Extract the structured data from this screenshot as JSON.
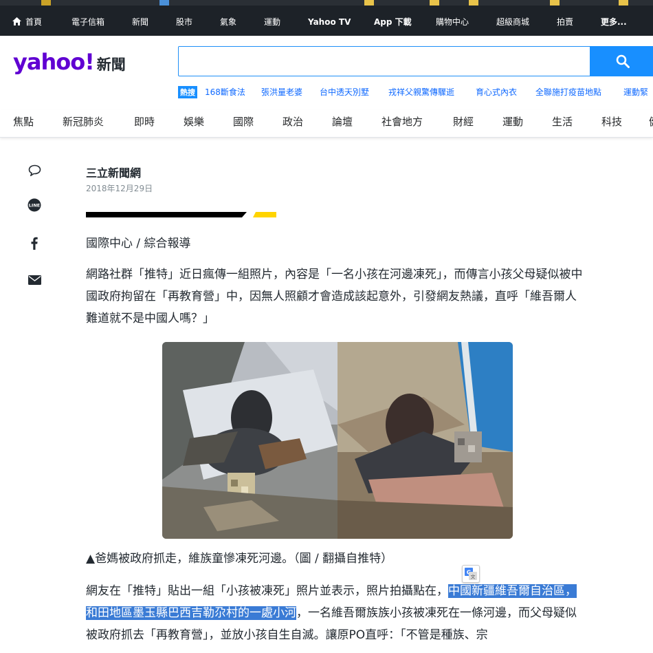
{
  "topnav": {
    "items": [
      "首頁",
      "電子信箱",
      "新聞",
      "股市",
      "氣象",
      "運動",
      "Yahoo TV",
      "App 下載",
      "購物中心",
      "超級商城",
      "拍賣",
      "更多..."
    ]
  },
  "header": {
    "logo_text": "yahoo!",
    "logo_section": "新聞",
    "search_placeholder": "",
    "trending_badge": "熱搜",
    "trending": [
      "168斷食法",
      "張洪量老婆",
      "台中透天別墅",
      "戎祥父親驚傳驟逝",
      "育心式內衣",
      "全聯施打疫苗地點",
      "運動緊"
    ]
  },
  "categories": [
    "焦點",
    "新冠肺炎",
    "即時",
    "娛樂",
    "國際",
    "政治",
    "論壇",
    "社會地方",
    "財經",
    "運動",
    "生活",
    "科技",
    "健"
  ],
  "share": [
    "comment-icon",
    "line-icon",
    "facebook-icon",
    "mail-icon"
  ],
  "article": {
    "source": "三立新聞網",
    "date": "2018年12月29日",
    "byline": "國際中心 / 綜合報導",
    "p1": "網路社群「推特」近日瘋傳一組照片，內容是「一名小孩在河邊凍死」，而傳言小孩父母疑似被中國政府拘留在「再教育營」中，因無人照顧才會造成該起意外，引發網友熱議，直呼「維吾爾人難道就不是中國人嗎？」",
    "caption": "▲爸媽被政府抓走，維族童慘凍死河邊。（圖 / 翻攝自推特）",
    "p2_a": "網友在「推特」貼出一組「小孩被凍死」照片並表示，照片拍攝點在，",
    "p2_highlight_1": "中國新疆維吾爾自治",
    "p2_highlight_2": "區，和田地區墨玉縣巴西吉勒尕村的一處小河",
    "p2_b": "，一名維吾爾族族小孩被凍死在一條河邊，而父母疑似被政府抓去「再教育營」，並放小孩自生自滅。讓原PO直呼：「不管是種族、宗"
  },
  "colors": {
    "brand": "#6001d2",
    "accent": "#188fff",
    "topbar": "#1d2228",
    "highlight": "#3a7bd5",
    "rule_yellow": "#ffd400"
  }
}
